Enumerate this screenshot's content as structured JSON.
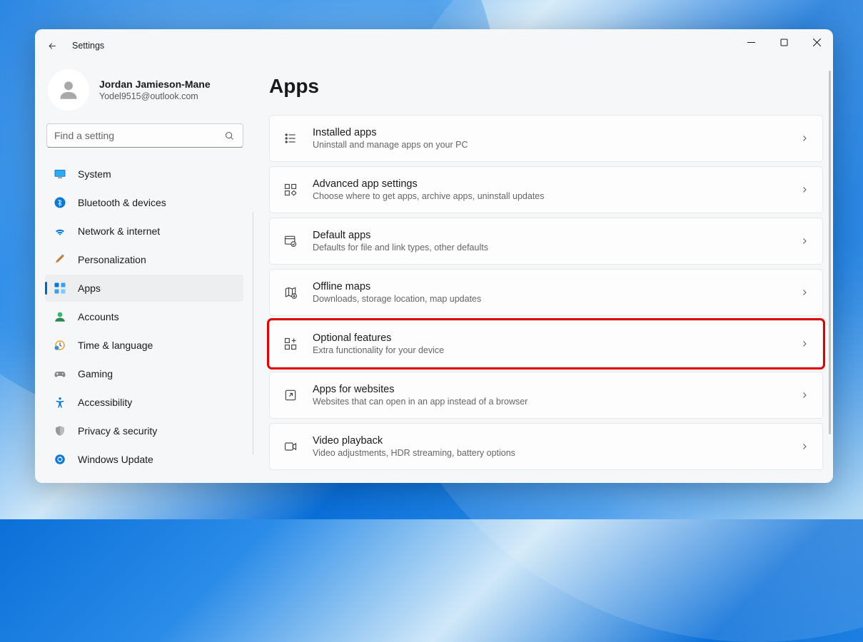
{
  "window": {
    "title": "Settings"
  },
  "user": {
    "name": "Jordan Jamieson-Mane",
    "email": "Yodel9515@outlook.com"
  },
  "search": {
    "placeholder": "Find a setting"
  },
  "nav": {
    "items": [
      {
        "label": "System"
      },
      {
        "label": "Bluetooth & devices"
      },
      {
        "label": "Network & internet"
      },
      {
        "label": "Personalization"
      },
      {
        "label": "Apps"
      },
      {
        "label": "Accounts"
      },
      {
        "label": "Time & language"
      },
      {
        "label": "Gaming"
      },
      {
        "label": "Accessibility"
      },
      {
        "label": "Privacy & security"
      },
      {
        "label": "Windows Update"
      }
    ],
    "selected_index": 4
  },
  "page": {
    "title": "Apps"
  },
  "cards": [
    {
      "title": "Installed apps",
      "sub": "Uninstall and manage apps on your PC"
    },
    {
      "title": "Advanced app settings",
      "sub": "Choose where to get apps, archive apps, uninstall updates"
    },
    {
      "title": "Default apps",
      "sub": "Defaults for file and link types, other defaults"
    },
    {
      "title": "Offline maps",
      "sub": "Downloads, storage location, map updates"
    },
    {
      "title": "Optional features",
      "sub": "Extra functionality for your device"
    },
    {
      "title": "Apps for websites",
      "sub": "Websites that can open in an app instead of a browser"
    },
    {
      "title": "Video playback",
      "sub": "Video adjustments, HDR streaming, battery options"
    }
  ],
  "highlighted_card_index": 4
}
